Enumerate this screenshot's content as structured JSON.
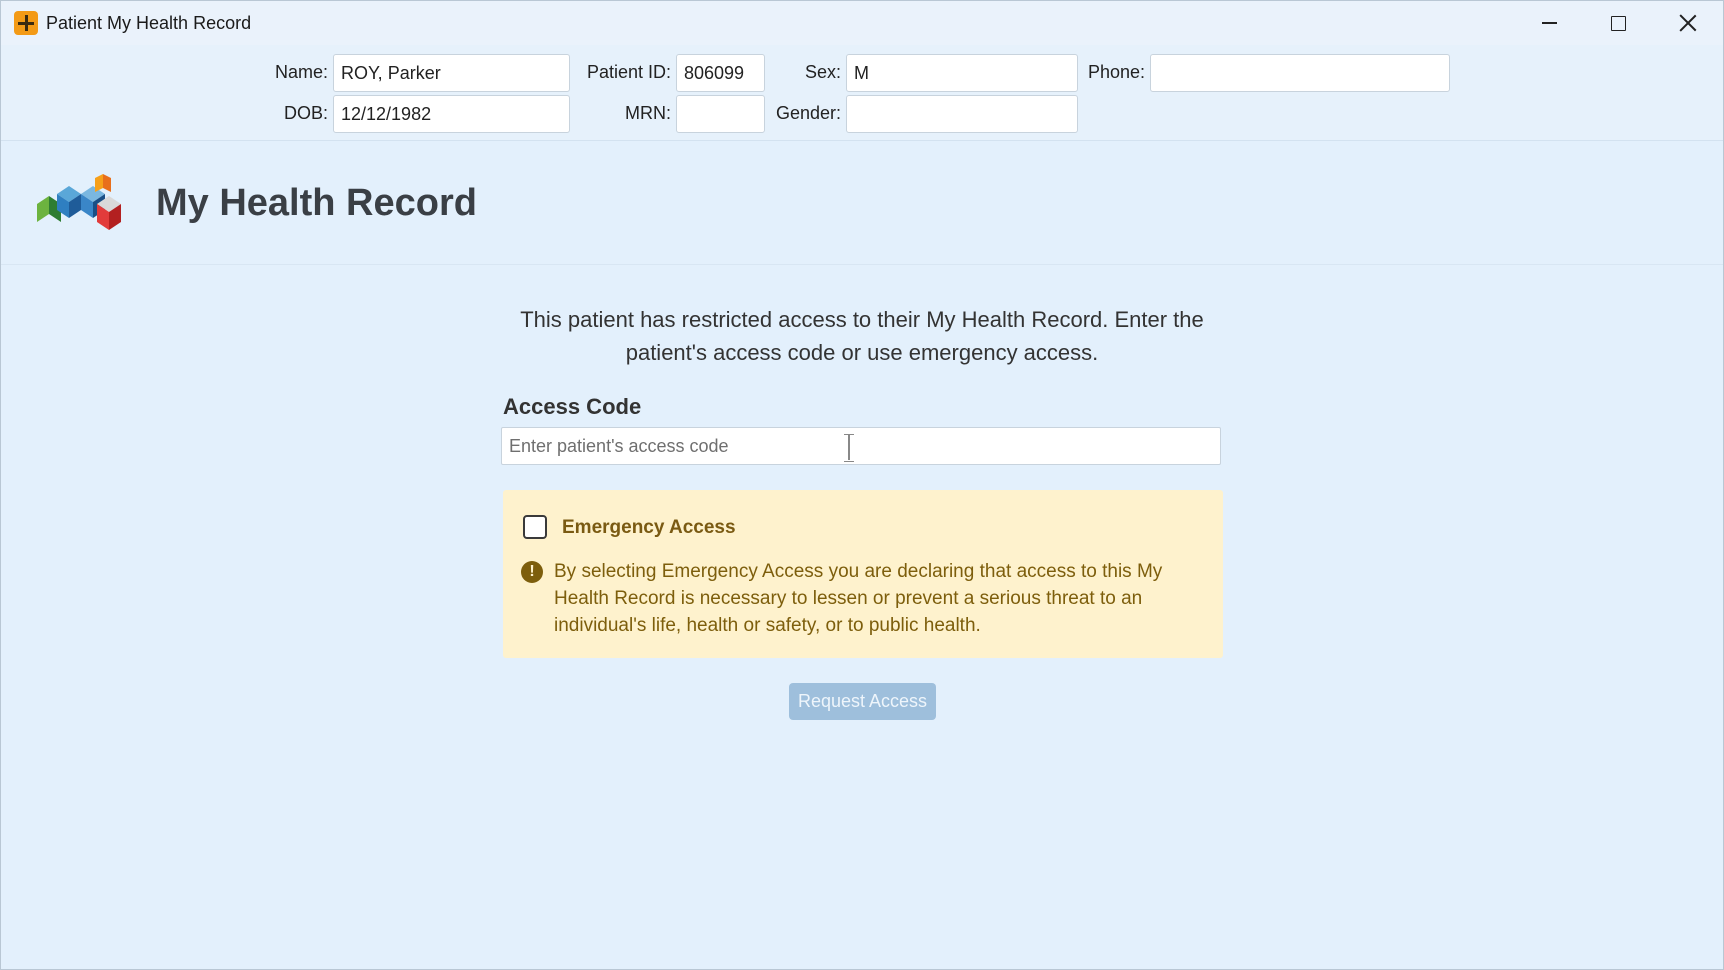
{
  "window": {
    "title": "Patient My Health Record"
  },
  "patient": {
    "name_label": "Name:",
    "name_value": "ROY, Parker",
    "dob_label": "DOB:",
    "dob_value": "12/12/1982",
    "patient_id_label": "Patient ID:",
    "patient_id_value": "806099",
    "mrn_label": "MRN:",
    "mrn_value": "",
    "sex_label": "Sex:",
    "sex_value": "M",
    "gender_label": "Gender:",
    "gender_value": "",
    "phone_label": "Phone:",
    "phone_value": ""
  },
  "brand": {
    "title": "My Health Record",
    "logo_icon": "my-health-record-logo"
  },
  "main": {
    "intro": "This patient has restricted access to their My Health Record. Enter the patient's access code or use emergency access.",
    "access_code_label": "Access Code",
    "access_code_placeholder": "Enter patient's access code",
    "access_code_value": "",
    "emergency": {
      "label": "Emergency Access",
      "checked": false,
      "warning_icon": "exclamation-circle-icon",
      "warning_text": "By selecting Emergency Access you are declaring that access to this My Health Record is necessary to lessen or prevent a serious threat to an individual's life, health or safety, or to public health."
    },
    "request_button": "Request Access"
  },
  "colors": {
    "background": "#e3f0fc",
    "warning_bg": "#fef2cd",
    "warning_text": "#7d5e0c",
    "button_disabled": "#9ebfdc",
    "app_icon": "#f39a16"
  }
}
